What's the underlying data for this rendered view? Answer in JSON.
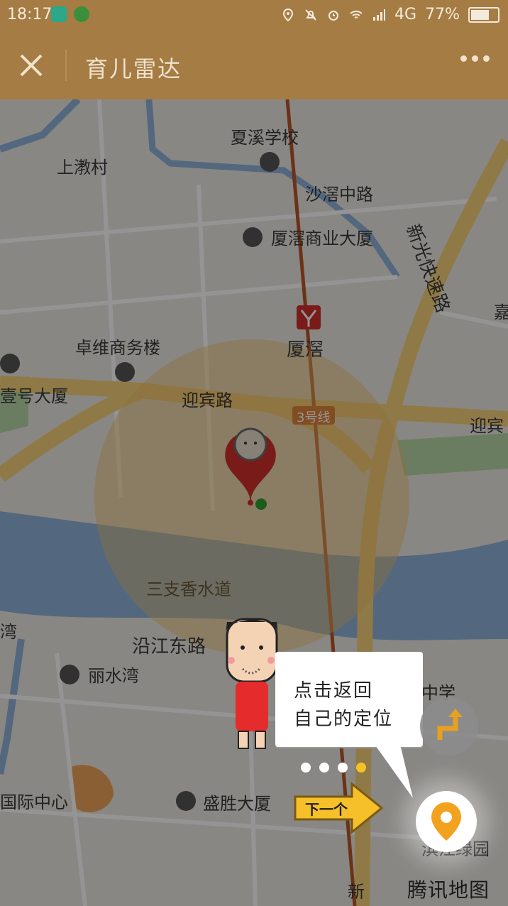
{
  "status_bar": {
    "time": "18:17",
    "network": "4G",
    "battery": "77%",
    "battery_level": 0.77
  },
  "title_bar": {
    "title": "育儿雷达",
    "close_icon": "close-icon",
    "more_icon": "more-dots-icon"
  },
  "map": {
    "labels": {
      "xiaxi_school": "夏溪学校",
      "shangyu_village": "上漖村",
      "shaxi_road": "沙滘中路",
      "xiaxi_building": "厦滘商业大厦",
      "xinguang_expressway": "新光快速路",
      "zhuowei": "卓维商务楼",
      "metro_station": "厦滘",
      "metro_line": "3号线",
      "yibin_road": "迎宾路",
      "yibin_road_right": "迎宾",
      "yihao_building": "壹号大厦",
      "sanzhi_waterway": "三支香水道",
      "yanjiang_east_road": "沿江东路",
      "lishui_bay": "丽水湾",
      "wan_left": "湾",
      "middle_school": "中学",
      "intl_center": "国际中心",
      "shengsheng_building": "盛胜大厦",
      "hanxi_garden": "滨江绿园",
      "xin_bottom": "新",
      "jia_right": "嘉",
      "tencent_map": "腾讯地图"
    }
  },
  "guide": {
    "bubble_line1": "点击返回",
    "bubble_line2": "自己的定位",
    "next_label": "下一个",
    "page_count": 4,
    "current_page": 4
  },
  "colors": {
    "header": "#a57c43",
    "accent": "#f5c02a",
    "water": "#8fb3d9",
    "road": "#f7d27a",
    "pin": "#d0302b"
  }
}
